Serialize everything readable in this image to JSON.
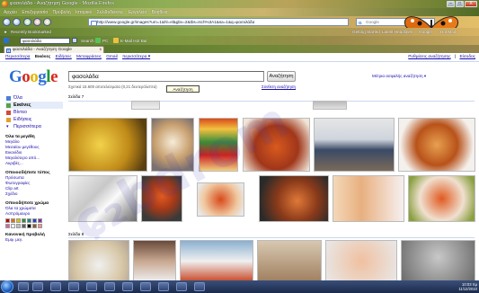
{
  "window": {
    "title": "φασολάδα - Αναζήτηση Google - Mozilla Firefox",
    "controls": [
      "–",
      "□",
      "X"
    ]
  },
  "menu": [
    "Αρχείο",
    "Επεξεργασία",
    "Προβολή",
    "Ιστορικό",
    "Σελιδοδείκτες",
    "Εργαλεία",
    "Βοήθεια"
  ],
  "nav": {
    "url": "http://www.google.gr/images?um=1&hl=el&gbv=2&tbs=isch%3A1&sa=1&q=φασολάδα",
    "search_engine_initial": "G",
    "search_placeholder": "Google"
  },
  "bookmarks": {
    "recently": "Recently Bookmarked",
    "right": [
      "Getting Started",
      "Latest Headlines",
      "Google",
      "Hot Mail"
    ]
  },
  "toolbar2": {
    "query": "φασολάδα",
    "search_label": "Search",
    "pc_label": "PC",
    "email_label": "E-Mail Hot Bar"
  },
  "tab": {
    "favicon": "g",
    "title": "φασολάδα - Αναζήτηση Google",
    "close": "x"
  },
  "gbar": {
    "links": [
      "Περισσότερα",
      "Εικόνες",
      "Ειδήσεις",
      "Μεταφράσεις",
      "Gmail"
    ],
    "current": "Εικόνες",
    "more_label": "περισσότερα ▾",
    "right": [
      "Ρυθμίσεις αναζήτησης",
      "|",
      "Είσοδος"
    ]
  },
  "search": {
    "logo": [
      "G",
      "o",
      "o",
      "g",
      "l",
      "e"
    ],
    "query": "φασολάδα",
    "button": "Αναζήτηση",
    "tooltip": "Αναζήτηση",
    "advanced": "Σύνθετη αναζήτηση",
    "stats": "Σχετικά 15.600 αποτελέσματα (0,21 δευτερόλεπτα)",
    "safesearch": "Μέτρια ασφαλής αναζήτηση ▾"
  },
  "leftnav": {
    "items": [
      {
        "label": "Όλα",
        "icon": "web-icon",
        "active": false
      },
      {
        "label": "Εικόνες",
        "icon": "images-icon",
        "active": true
      },
      {
        "label": "Βίντεο",
        "icon": "video-icon",
        "active": false
      },
      {
        "label": "Ειδήσεις",
        "icon": "news-icon",
        "active": false
      },
      {
        "label": "Περισσότερα",
        "icon": "more-icon",
        "active": false
      }
    ],
    "size_title": "Όλα τα μεγέθη",
    "sizes": [
      "Μεγάλο",
      "Μεσαίου μεγέθους",
      "Εικονίδιο",
      "Μεγαλύτερο από...",
      "Ακριβές..."
    ],
    "type_title": "Οποιοσδήποτε τύπος",
    "types": [
      "Πρόσωπα",
      "Φωτογραφίες",
      "Clip art",
      "Σχέδιο"
    ],
    "color_title": "Οποιοδήποτε χρώμα",
    "color_links": [
      "Όλα τα χρώματα",
      "Ασπρόμαυρο"
    ],
    "colors": [
      "#c00000",
      "#e07000",
      "#e0c000",
      "#309030",
      "#208080",
      "#2040c0",
      "#8030a0",
      "#e060a0",
      "#ffffff",
      "#c0c0c0",
      "#606060",
      "#000000",
      "#8b5a2b",
      "#ff9090"
    ],
    "standard_title": "Κανονική προβολή",
    "standard_link": "Εμφ. μεγ."
  },
  "results": {
    "page7_label": "Σελίδα 7",
    "page8_label": "Σελίδα 8"
  },
  "taskbar": {
    "clock": "10:03 πμ",
    "date": "11/12/2010"
  },
  "watermark": "ɕ₂bdrom"
}
